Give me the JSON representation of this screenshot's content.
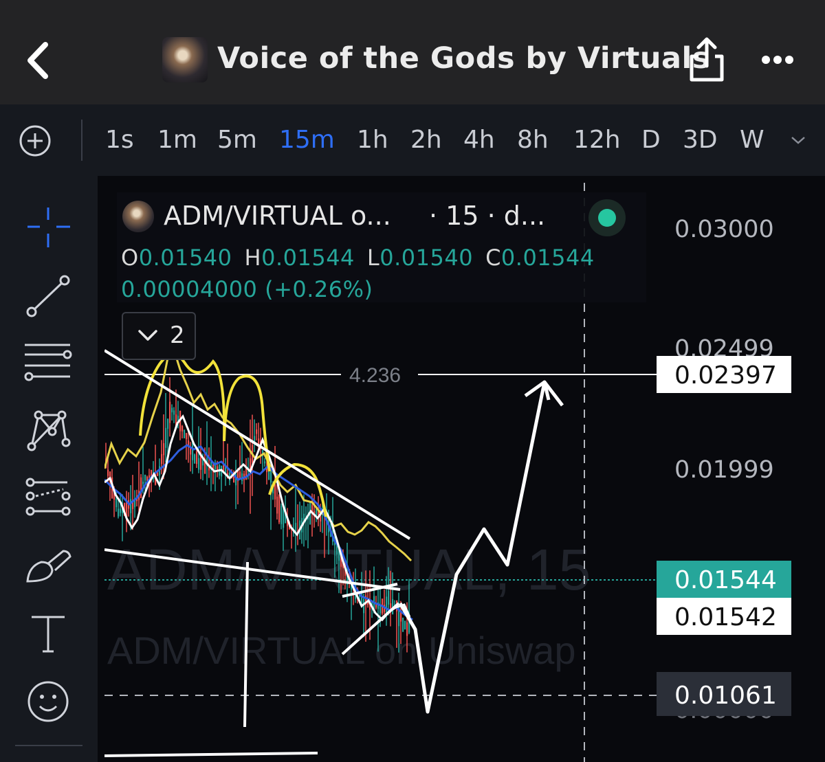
{
  "header": {
    "title": "Voice of the Gods by Virtuals",
    "back_icon": "chevron-left-icon",
    "share_icon": "share-icon",
    "more_icon": "more-dots-icon"
  },
  "timeframes": {
    "items": [
      "1s",
      "1m",
      "5m",
      "15m",
      "1h",
      "2h",
      "4h",
      "8h",
      "12h",
      "D",
      "3D",
      "W"
    ],
    "active": "15m",
    "active_color": "#2e6ef5"
  },
  "toolbar": {
    "tools": [
      "crosshair-icon",
      "trend-line-icon",
      "fib-retracement-icon",
      "pattern-icon",
      "prediction-icon",
      "brush-icon",
      "text-icon",
      "emoji-icon"
    ],
    "active_color": "#2e6ef5"
  },
  "legend": {
    "symbol": "ADM/VIRTUAL o...",
    "interval": "· 15 · d...",
    "open_key": "O",
    "open": "0.01540",
    "high_key": "H",
    "high": "0.01544",
    "low_key": "L",
    "low": "0.01540",
    "close_key": "C",
    "close": "0.01544",
    "change": "0.00004000 (+0.26%)",
    "indicators_count": "2",
    "up_color": "#26a69a"
  },
  "watermark": {
    "line1": "ADM/VIRTUAL, 15",
    "line2": "ADM/VIRTUAL on Uniswap"
  },
  "chart_data": {
    "type": "line",
    "price_scale": [
      "0.03000",
      "0.02499",
      "0.01999"
    ],
    "fib_level_label": "4.236",
    "fib_level_price": "0.02397",
    "last_price": "0.01544",
    "crosshair_price": "0.01542",
    "low_marker_price": "0.01061",
    "partial_label": "0.00000",
    "colors": {
      "candle_up": "#26a69a",
      "candle_down": "#ef5350",
      "ma_fast": "#ffffff",
      "ma_mid": "#2f5fe0",
      "ma_slow": "#e6d24a",
      "drawing_yellow": "#f2e23a",
      "drawing_white": "#ffffff"
    }
  }
}
